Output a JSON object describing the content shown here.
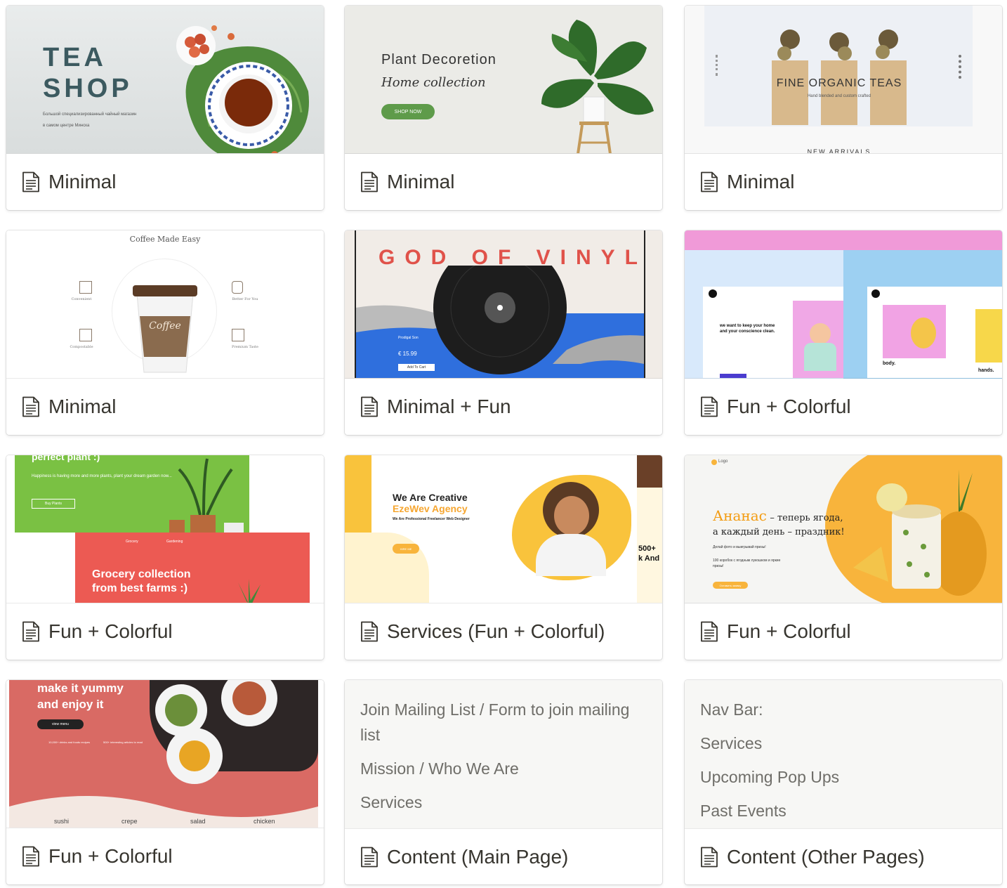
{
  "cards": [
    {
      "title": "Minimal",
      "preview": {
        "heading_1": "TEA",
        "heading_2": "SHOP",
        "line_1": "Большой специализированный чайный магазин",
        "line_2": "в самом центре Минска"
      }
    },
    {
      "title": "Minimal",
      "preview": {
        "heading": "Plant Decoretion",
        "subheading": "Home collection",
        "button": "SHOP NOW"
      }
    },
    {
      "title": "Minimal",
      "preview": {
        "heading": "FINE ORGANIC TEAS",
        "subheading": "Hand blended and custom crafted",
        "section": "NEW ARRIVALS"
      }
    },
    {
      "title": "Minimal",
      "preview": {
        "heading": "Coffee Made Easy",
        "cup_label": "Coffee",
        "feature_1": "Convenient",
        "feature_2": "Better For You",
        "feature_3": "Compostable",
        "feature_4": "Premium Taste"
      }
    },
    {
      "title": "Minimal + Fun",
      "preview": {
        "heading": "GOD OF VINYL",
        "product": "Prodigal Son",
        "price": "€ 15.99",
        "button": "Add To Cart"
      }
    },
    {
      "title": "Fun + Colorful",
      "preview": {
        "tagline": "we want to keep your home and your conscience clean.",
        "label_1": "body.",
        "label_2": "hands."
      }
    },
    {
      "title": "Fun + Colorful",
      "preview": {
        "top_heading": "perfect plant :)",
        "top_text": "Happiness is having more and more plants, plant your dream garden now...",
        "top_button": "Buy Plants",
        "nav_1": "Grocery",
        "nav_2": "Gardening",
        "heading_line_1": "Grocery collection",
        "heading_line_2": "from best farms :)"
      }
    },
    {
      "title": "Services (Fun + Colorful)",
      "preview": {
        "heading_1": "We Are Creative",
        "heading_2": "EzeWev Agency",
        "subheading": "We Are Professional Freelancer Web Designer",
        "button": "HIRE ME",
        "side_1": "500+",
        "side_2": "k And"
      }
    },
    {
      "title": "Fun + Colorful",
      "preview": {
        "logo": "Logo",
        "heading_accent": "Ананас",
        "heading_rest": "– теперь ягода,",
        "heading_line_2": "а каждый день – праздник!",
        "text_1": "Делай фото и выигрывай призы!",
        "text_2": "100 коробок с ягодным лукошком и яркие призы!",
        "button": "Оставить заявку"
      }
    },
    {
      "title": "Fun + Colorful",
      "preview": {
        "heading_1": "make it yummy",
        "heading_2": "and enjoy it",
        "button": "view menu",
        "stat_1": "10,000+ drinks and foods recipes",
        "stat_2": "500+ interesting articles to read",
        "cat_1": "sushi",
        "cat_2": "crepe",
        "cat_3": "salad",
        "cat_4": "chicken"
      }
    },
    {
      "title": "Content (Main Page)",
      "lines": [
        "Join Mailing List / Form to join mailing list",
        "Mission / Who We Are",
        "Services"
      ]
    },
    {
      "title": "Content (Other Pages)",
      "lines": [
        "Nav Bar:",
        "Services",
        "Upcoming Pop Ups",
        "Past Events"
      ]
    }
  ],
  "colors": {
    "text": "#37352f",
    "muted": "#6f6e69",
    "border": "#e3e3e1",
    "coral": "#ec5a53",
    "green": "#7ac143",
    "orange": "#f8b43c"
  },
  "icons": {
    "card_icon": "page-icon"
  }
}
